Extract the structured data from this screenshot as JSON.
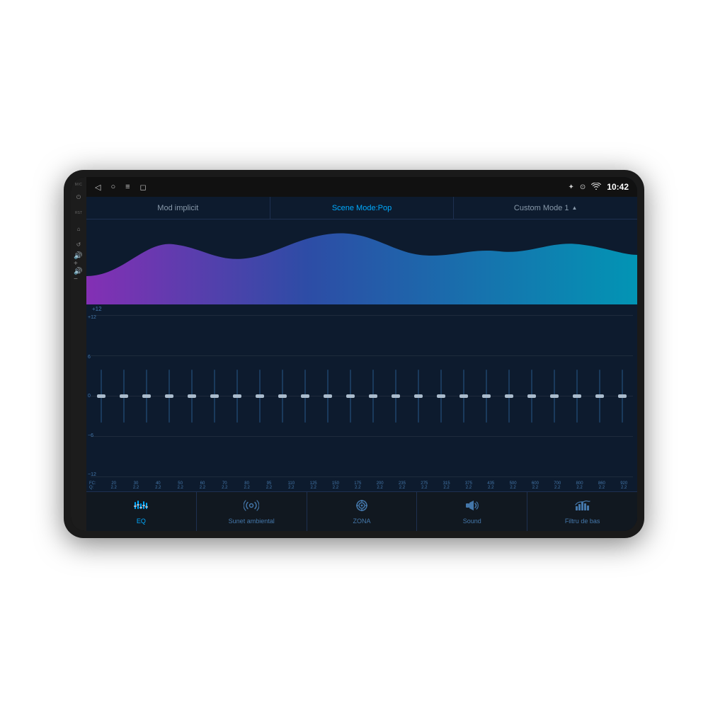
{
  "device": {
    "mic_label": "MIC",
    "rst_label": "RST"
  },
  "status_bar": {
    "time": "10:42",
    "nav_icons": [
      "◁",
      "○",
      "≡",
      "◻"
    ],
    "status_icons": [
      "bluetooth",
      "location",
      "wifi",
      "time"
    ]
  },
  "top_tabs": [
    {
      "id": "mod-implicit",
      "label": "Mod implicit",
      "active": false
    },
    {
      "id": "scene-mode",
      "label": "Scene Mode:Pop",
      "active": true
    },
    {
      "id": "custom-mode",
      "label": "Custom Mode 1",
      "active": false,
      "has_arrow": true
    }
  ],
  "eq": {
    "labels": {
      "plus12": "+12",
      "plus6": "6",
      "zero": "0",
      "minus6": "-6",
      "minus12": "-12"
    },
    "bands": [
      {
        "freq": "20",
        "q": "2.2",
        "position": 0.5
      },
      {
        "freq": "30",
        "q": "2.2",
        "position": 0.5
      },
      {
        "freq": "40",
        "q": "2.2",
        "position": 0.5
      },
      {
        "freq": "50",
        "q": "2.2",
        "position": 0.5
      },
      {
        "freq": "60",
        "q": "2.2",
        "position": 0.5
      },
      {
        "freq": "70",
        "q": "2.2",
        "position": 0.5
      },
      {
        "freq": "80",
        "q": "2.2",
        "position": 0.5
      },
      {
        "freq": "95",
        "q": "2.2",
        "position": 0.5
      },
      {
        "freq": "110",
        "q": "2.2",
        "position": 0.5
      },
      {
        "freq": "125",
        "q": "2.2",
        "position": 0.5
      },
      {
        "freq": "150",
        "q": "2.2",
        "position": 0.5
      },
      {
        "freq": "175",
        "q": "2.2",
        "position": 0.5
      },
      {
        "freq": "200",
        "q": "2.2",
        "position": 0.5
      },
      {
        "freq": "235",
        "q": "2.2",
        "position": 0.5
      },
      {
        "freq": "275",
        "q": "2.2",
        "position": 0.5
      },
      {
        "freq": "315",
        "q": "2.2",
        "position": 0.5
      },
      {
        "freq": "375",
        "q": "2.2",
        "position": 0.5
      },
      {
        "freq": "435",
        "q": "2.2",
        "position": 0.5
      },
      {
        "freq": "500",
        "q": "2.2",
        "position": 0.5
      },
      {
        "freq": "600",
        "q": "2.2",
        "position": 0.5
      },
      {
        "freq": "700",
        "q": "2.2",
        "position": 0.5
      },
      {
        "freq": "800",
        "q": "2.2",
        "position": 0.5
      },
      {
        "freq": "860",
        "q": "2.2",
        "position": 0.5
      },
      {
        "freq": "920",
        "q": "2.2",
        "position": 0.5
      }
    ]
  },
  "bottom_nav": [
    {
      "id": "eq",
      "label": "EQ",
      "icon": "eq",
      "active": true
    },
    {
      "id": "sunet-ambiental",
      "label": "Sunet ambiental",
      "icon": "radio_waves",
      "active": false
    },
    {
      "id": "zona",
      "label": "ZONA",
      "icon": "target",
      "active": false
    },
    {
      "id": "sound",
      "label": "Sound",
      "icon": "speaker",
      "active": false
    },
    {
      "id": "filtru-de-bas",
      "label": "Filtru de bas",
      "icon": "bars_filter",
      "active": false
    }
  ]
}
